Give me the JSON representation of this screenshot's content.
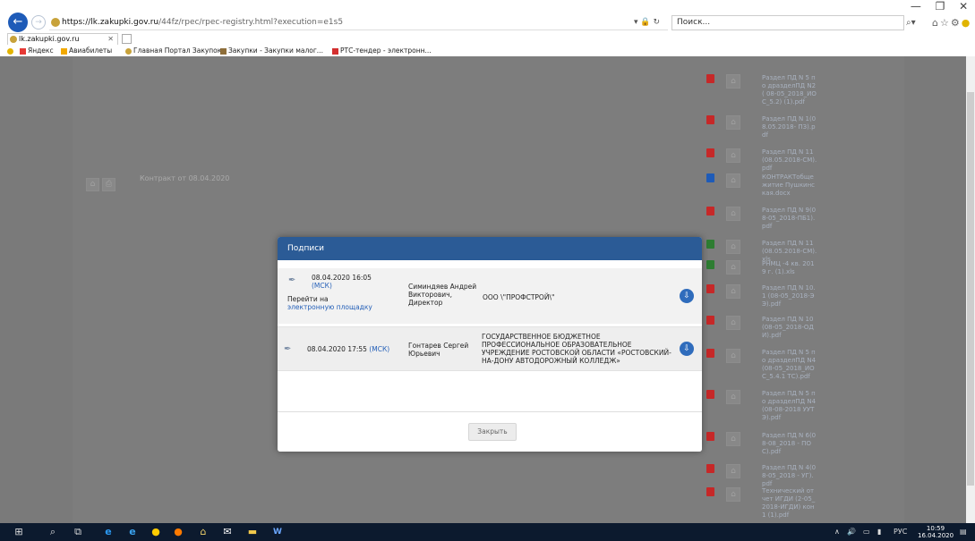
{
  "browser": {
    "url_host": "https://lk.zakupki.gov.ru",
    "url_rest": "/44fz/rpec/rpec-registry.html?execution=e1s5",
    "search_placeholder": "Поиск...",
    "tab_title": "lk.zakupki.gov.ru",
    "favorites": [
      {
        "label": "Яндекс",
        "color": "#e53935"
      },
      {
        "label": "Авиабилеты",
        "color": "#f2a900"
      },
      {
        "label": "Главная Портал Закупок",
        "color": "#c8a23a"
      },
      {
        "label": "Закупки - Закупки малог...",
        "color": "#8e6e3a"
      },
      {
        "label": "РТС-тендер - электронн...",
        "color": "#d32f2f"
      }
    ]
  },
  "page": {
    "contract_label": "Контракт от 08.04.2020",
    "files": [
      {
        "name": "Раздел ПД N 5 по дразделПД N2( 08-05_2018_ИОС_5.2) (1).pdf",
        "type": "pdf"
      },
      {
        "name": "Раздел ПД N 1(08.05.2018- ПЗ).pdf",
        "type": "pdf"
      },
      {
        "name": "Раздел ПД N 11(08.05.2018-СМ).pdf",
        "type": "pdf"
      },
      {
        "name": "КОНТРАКТобщежитие Пушкинская.docx",
        "type": "doc"
      },
      {
        "name": "Раздел ПД N 9(08-05_2018-ПБ1).pdf",
        "type": "pdf"
      },
      {
        "name": "Раздел ПД N 11(08.05.2018-СМ).xls",
        "type": "xls"
      },
      {
        "name": "РНМЦ -4 кв. 2019 г. (1).xls",
        "type": "xls"
      },
      {
        "name": "Раздел ПД N 10.1 (08-05_2018-ЭЭ).pdf",
        "type": "pdf"
      },
      {
        "name": "Раздел ПД N 10(08-05_2018-ОДИ).pdf",
        "type": "pdf"
      },
      {
        "name": "Раздел ПД N 5 по дразделПД N4(08-05_2018_ИОС_5.4.1 ТС).pdf",
        "type": "pdf"
      },
      {
        "name": "Раздел ПД N 5 по дразделПД N4(08-08-2018 УУТЭ).pdf",
        "type": "pdf"
      },
      {
        "name": "Раздел ПД N 6(08-08_2018 - ПОС).pdf",
        "type": "pdf"
      },
      {
        "name": "Раздел ПД N 4(08-05_2018 - УГ).pdf",
        "type": "pdf"
      },
      {
        "name": "Технический отчет ИГДИ (2-05_2018-ИГДИ) кон1 (1).pdf",
        "type": "pdf"
      }
    ]
  },
  "modal": {
    "title": "Подписи",
    "signatures": [
      {
        "datetime": "08.04.2020 16:05",
        "tz": "(МСК)",
        "goto_prefix": "Перейти на",
        "goto_link": "электронную площадку",
        "signer": "Симиндяев Андрей Викторович, Директор",
        "org": "ООО \\\"ПРОФСТРОЙ\\\""
      },
      {
        "datetime": "08.04.2020 17:55",
        "tz": "(МСК)",
        "signer": "Гонтарев Сергей Юрьевич",
        "org": "ГОСУДАРСТВЕННОЕ БЮДЖЕТНОЕ ПРОФЕССИОНАЛЬНОЕ ОБРАЗОВАТЕЛЬНОЕ УЧРЕЖДЕНИЕ РОСТОВСКОЙ ОБЛАСТИ «РОСТОВСКИЙ-НА-ДОНУ АВТОДОРОЖНЫЙ КОЛЛЕДЖ»"
      }
    ],
    "close_label": "Закрыть"
  },
  "taskbar": {
    "lang": "РУС",
    "time": "10:59",
    "date": "16.04.2020"
  },
  "colors": {
    "modal_header": "#2b5b96",
    "link": "#2560b8",
    "pdf_icon": "#c62828",
    "xls_icon": "#2e7d32",
    "doc_icon": "#1e5bb8"
  }
}
